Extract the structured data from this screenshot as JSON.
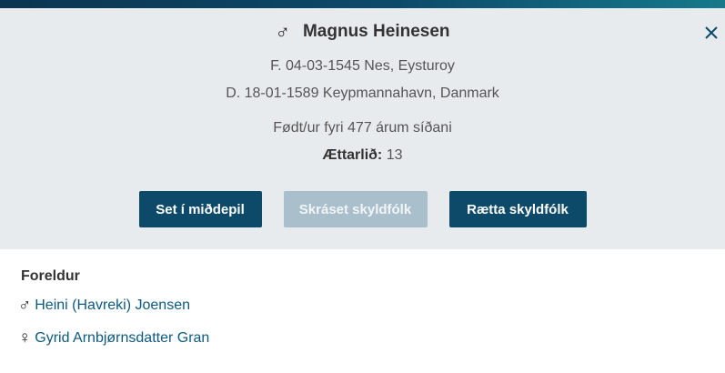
{
  "person": {
    "gender_symbol": "♂",
    "name": "Magnus Heinesen",
    "born": "F. 04-03-1545 Nes, Eysturoy",
    "died": "D. 18-01-1589 Keypmannahavn, Danmark",
    "age_text": "Født/ur fyri 477 árum síðani",
    "generation_label": "Ættarlið:",
    "generation_value": "13"
  },
  "buttons": {
    "center": "Set í miðdepil",
    "register": "Skráset skyldfólk",
    "edit": "Rætta skyldfólk"
  },
  "close_icon": "close-icon",
  "parents": {
    "title": "Foreldur",
    "items": [
      {
        "symbol": "♂",
        "name": "Heini (Havreki) Joensen"
      },
      {
        "symbol": "♀",
        "name": "Gyrid Arnbjørnsdatter Gran"
      }
    ]
  },
  "colors": {
    "primary": "#0d4a6a",
    "disabled": "#a9bfcb",
    "panel_bg": "#e8ebee",
    "link": "#0d5a7e"
  }
}
